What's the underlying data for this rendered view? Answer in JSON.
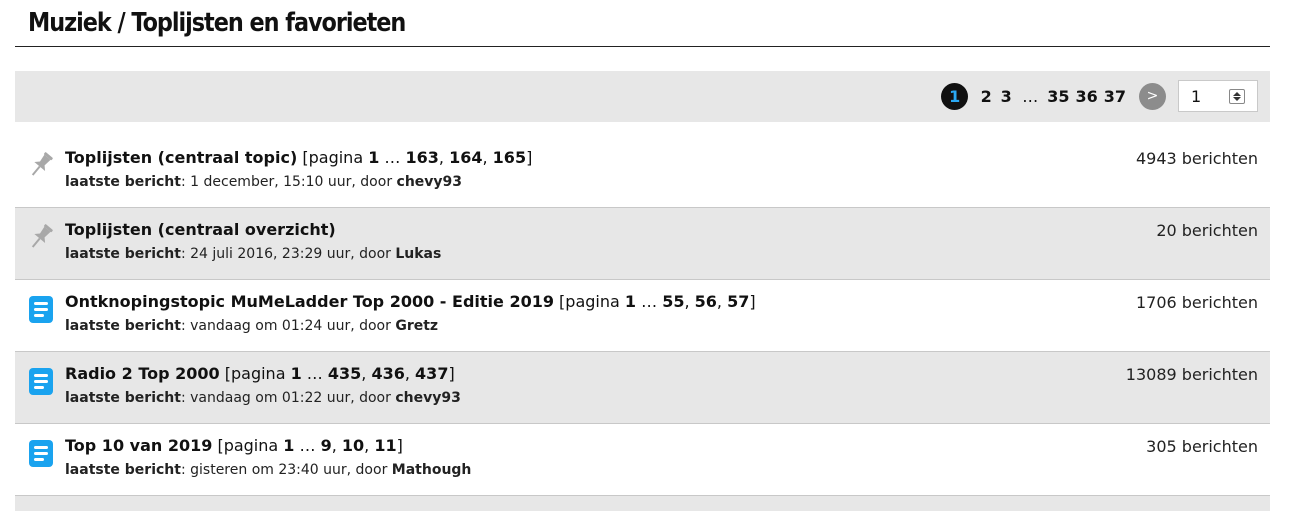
{
  "page": {
    "title": "Muziek / Toplijsten en favorieten"
  },
  "pagination": {
    "current": "1",
    "pages": [
      "2",
      "3"
    ],
    "ellipsis": "…",
    "last_pages": [
      "35",
      "36",
      "37"
    ],
    "next_label": ">",
    "input_value": "1"
  },
  "colors": {
    "accent": "#1aa3ef",
    "current_page_text": "#2aa8f2",
    "alt_row": "#e7e7e7",
    "pin": "#a8a8a8"
  },
  "topics": [
    {
      "icon": "pin-icon",
      "title": "Toplijsten (centraal topic)",
      "pages_open": " [pagina ",
      "page_first": "1",
      "page_ellipsis": " … ",
      "page_a": "163",
      "sep1": ", ",
      "page_b": "164",
      "sep2": ", ",
      "page_c": "165",
      "pages_close": "]",
      "last_label": "laatste bericht",
      "last_text": ": 1 december, 15:10 uur, door ",
      "author": "chevy93",
      "count": "4943 berichten"
    },
    {
      "icon": "pin-icon",
      "title": "Toplijsten (centraal overzicht)",
      "last_label": "laatste bericht",
      "last_text": ": 24 juli 2016, 23:29 uur, door ",
      "author": "Lukas",
      "count": "20 berichten"
    },
    {
      "icon": "document-icon",
      "title": "Ontknopingstopic MuMeLadder Top 2000 - Editie 2019",
      "pages_open": " [pagina ",
      "page_first": "1",
      "page_ellipsis": " … ",
      "page_a": "55",
      "sep1": ", ",
      "page_b": "56",
      "sep2": ", ",
      "page_c": "57",
      "pages_close": "]",
      "last_label": "laatste bericht",
      "last_text": ": vandaag om 01:24 uur, door ",
      "author": "Gretz",
      "count": "1706 berichten"
    },
    {
      "icon": "document-icon",
      "title": "Radio 2 Top 2000",
      "pages_open": " [pagina ",
      "page_first": "1",
      "page_ellipsis": " … ",
      "page_a": "435",
      "sep1": ", ",
      "page_b": "436",
      "sep2": ", ",
      "page_c": "437",
      "pages_close": "]",
      "last_label": "laatste bericht",
      "last_text": ": vandaag om 01:22 uur, door ",
      "author": "chevy93",
      "count": "13089 berichten"
    },
    {
      "icon": "document-icon",
      "title": "Top 10 van 2019",
      "pages_open": " [pagina ",
      "page_first": "1",
      "page_ellipsis": " … ",
      "page_a": "9",
      "sep1": ", ",
      "page_b": "10",
      "sep2": ", ",
      "page_c": "11",
      "pages_close": "]",
      "last_label": "laatste bericht",
      "last_text": ": gisteren om 23:40 uur, door ",
      "author": "Mathough",
      "count": "305 berichten"
    }
  ]
}
